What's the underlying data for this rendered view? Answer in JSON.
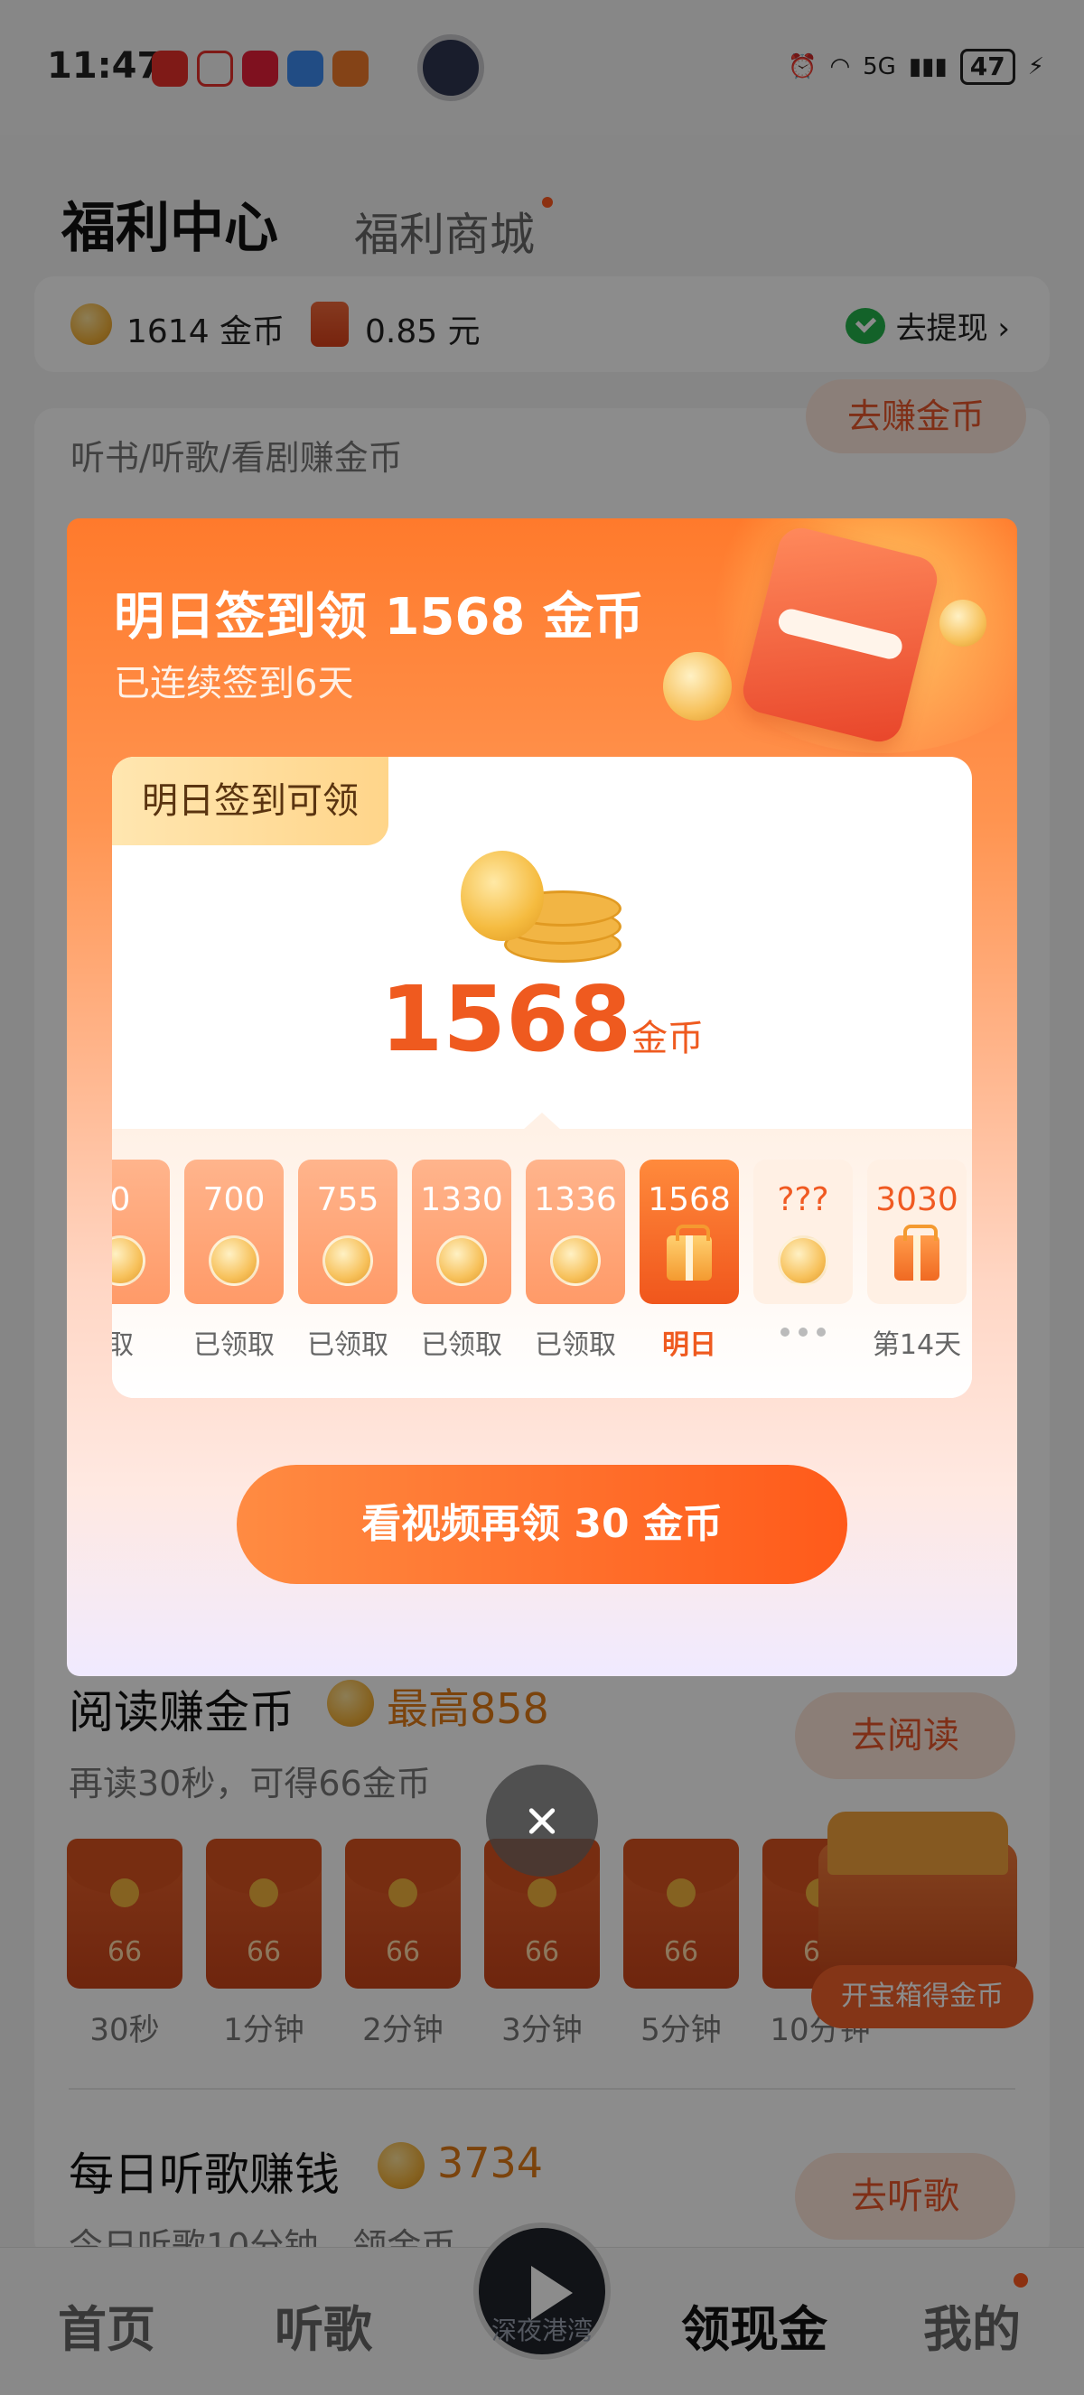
{
  "status_bar": {
    "time": "11:47",
    "battery": "47",
    "network": "5G"
  },
  "header": {
    "tab_active": "福利中心",
    "tab_other": "福利商城"
  },
  "balance": {
    "coins": "1614 金币",
    "cash": "0.85 元",
    "withdraw_label": "去提现 ›"
  },
  "listen_section": {
    "subtitle": "听书/听歌/看剧赚金币",
    "button": "去赚金币"
  },
  "modal": {
    "title": "明日签到领 1568 金币",
    "subtitle": "已连续签到6天",
    "tag": "明日签到可领",
    "amount": "1568",
    "amount_unit": "金币",
    "days": [
      {
        "value": "0",
        "label": "取",
        "kind": "claimed"
      },
      {
        "value": "700",
        "label": "已领取",
        "kind": "claimed"
      },
      {
        "value": "755",
        "label": "已领取",
        "kind": "claimed"
      },
      {
        "value": "1330",
        "label": "已领取",
        "kind": "claimed"
      },
      {
        "value": "1336",
        "label": "已领取",
        "kind": "claimed"
      },
      {
        "value": "1568",
        "label": "明日",
        "kind": "today"
      },
      {
        "value": "???",
        "label": "",
        "kind": "future-coin"
      },
      {
        "value": "3030",
        "label": "第14天",
        "kind": "future-gift"
      }
    ],
    "cta": "看视频再领 30 金币"
  },
  "read_section": {
    "title": "阅读赚金币",
    "max": "最高858",
    "subtitle": "再读30秒，可得66金币",
    "button": "去阅读",
    "packs": [
      {
        "value": "66",
        "label": "30秒"
      },
      {
        "value": "66",
        "label": "1分钟"
      },
      {
        "value": "66",
        "label": "2分钟"
      },
      {
        "value": "66",
        "label": "3分钟"
      },
      {
        "value": "66",
        "label": "5分钟"
      },
      {
        "value": "66",
        "label": "10分钟"
      }
    ],
    "chest_label": "开宝箱得金币"
  },
  "music_section": {
    "title": "每日听歌赚钱",
    "value": "3734",
    "subtitle": "今日听歌10分钟，领金币",
    "button": "去听歌"
  },
  "bottom_nav": {
    "items": [
      "首页",
      "听歌",
      "领现金",
      "我的"
    ],
    "play_caption": "深夜港湾"
  },
  "colors": {
    "accent": "#ff5a1a",
    "coin": "#f3b33d",
    "text": "#222222"
  }
}
